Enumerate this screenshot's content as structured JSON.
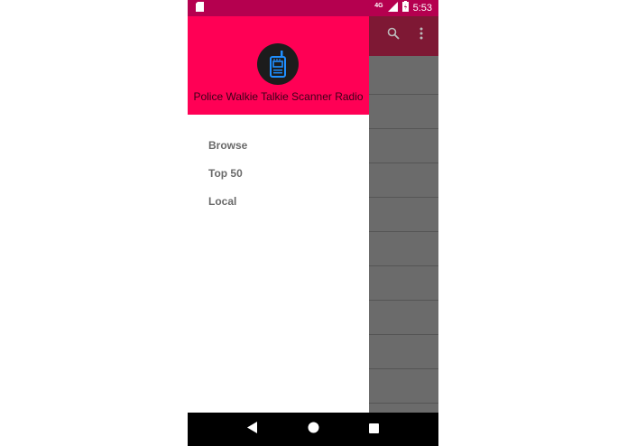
{
  "status_bar": {
    "network": "4G",
    "time": "5:53",
    "icons": [
      "sim-card-icon",
      "signal-icon",
      "battery-charging-icon"
    ]
  },
  "toolbar": {
    "icons": [
      "search-icon",
      "more-vert-icon"
    ]
  },
  "drawer": {
    "logo_icon": "walkie-talkie-icon",
    "title": "Police Walkie Talkie Scanner Radio",
    "header_color": "#ff0055",
    "items": [
      {
        "label": "Browse"
      },
      {
        "label": "Top 50"
      },
      {
        "label": "Local"
      }
    ]
  },
  "nav_bar": {
    "icons": [
      "back-icon",
      "home-icon",
      "recents-icon"
    ]
  },
  "colors": {
    "status_bar": "#b5004f",
    "scrim": "#6b6b6b",
    "menu_text": "#6a6a6a"
  }
}
